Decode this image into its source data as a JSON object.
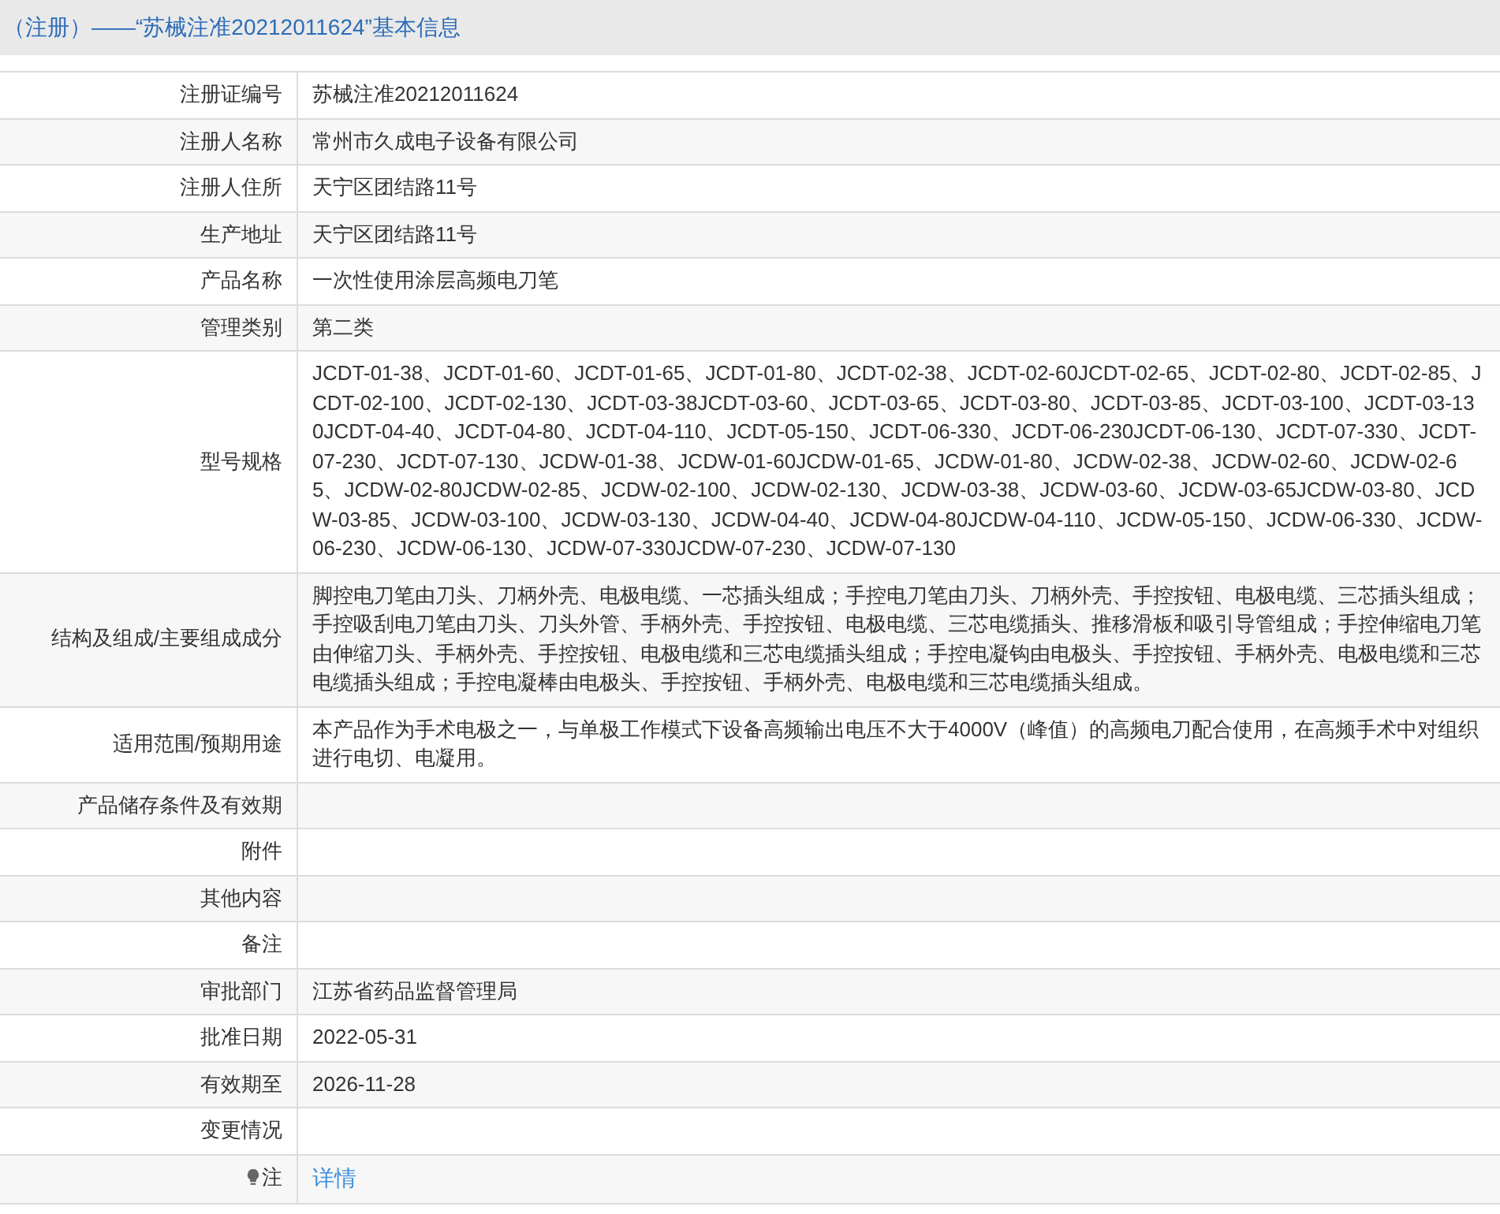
{
  "title": "（注册）——“苏械注准20212011624”基本信息",
  "rows": [
    {
      "kind": "text",
      "label": "注册证编号",
      "value": "苏械注准20212011624"
    },
    {
      "kind": "text",
      "label": "注册人名称",
      "value": "常州市久成电子设备有限公司"
    },
    {
      "kind": "text",
      "label": "注册人住所",
      "value": "天宁区团结路11号"
    },
    {
      "kind": "text",
      "label": "生产地址",
      "value": "天宁区团结路11号"
    },
    {
      "kind": "text",
      "label": "产品名称",
      "value": "一次性使用涂层高频电刀笔"
    },
    {
      "kind": "text",
      "label": "管理类别",
      "value": "第二类"
    },
    {
      "kind": "text",
      "label": "型号规格",
      "value": "JCDT-01-38、JCDT-01-60、JCDT-01-65、JCDT-01-80、JCDT-02-38、JCDT-02-60JCDT-02-65、JCDT-02-80、JCDT-02-85、JCDT-02-100、JCDT-02-130、JCDT-03-38JCDT-03-60、JCDT-03-65、JCDT-03-80、JCDT-03-85、JCDT-03-100、JCDT-03-130JCDT-04-40、JCDT-04-80、JCDT-04-110、JCDT-05-150、JCDT-06-330、JCDT-06-230JCDT-06-130、JCDT-07-330、JCDT-07-230、JCDT-07-130、JCDW-01-38、JCDW-01-60JCDW-01-65、JCDW-01-80、JCDW-02-38、JCDW-02-60、JCDW-02-65、JCDW-02-80JCDW-02-85、JCDW-02-100、JCDW-02-130、JCDW-03-38、JCDW-03-60、JCDW-03-65JCDW-03-80、JCDW-03-85、JCDW-03-100、JCDW-03-130、JCDW-04-40、JCDW-04-80JCDW-04-110、JCDW-05-150、JCDW-06-330、JCDW-06-230、JCDW-06-130、JCDW-07-330JCDW-07-230、JCDW-07-130"
    },
    {
      "kind": "text",
      "label": "结构及组成/主要组成成分",
      "value": "脚控电刀笔由刀头、刀柄外壳、电极电缆、一芯插头组成；手控电刀笔由刀头、刀柄外壳、手控按钮、电极电缆、三芯插头组成；手控吸刮电刀笔由刀头、刀头外管、手柄外壳、手控按钮、电极电缆、三芯电缆插头、推移滑板和吸引导管组成；手控伸缩电刀笔由伸缩刀头、手柄外壳、手控按钮、电极电缆和三芯电缆插头组成；手控电凝钩由电极头、手控按钮、手柄外壳、电极电缆和三芯电缆插头组成；手控电凝棒由电极头、手控按钮、手柄外壳、电极电缆和三芯电缆插头组成。"
    },
    {
      "kind": "text",
      "label": "适用范围/预期用途",
      "value": "本产品作为手术电极之一，与单极工作模式下设备高频输出电压不大于4000V（峰值）的高频电刀配合使用，在高频手术中对组织进行电切、电凝用。"
    },
    {
      "kind": "text",
      "label": "产品储存条件及有效期"
    },
    {
      "kind": "text",
      "label": "附件"
    },
    {
      "kind": "text",
      "label": "其他内容"
    },
    {
      "kind": "text",
      "label": "备注"
    },
    {
      "kind": "text",
      "label": "审批部门",
      "value": "江苏省药品监督管理局"
    },
    {
      "kind": "text",
      "label": "批准日期",
      "value": "2022-05-31"
    },
    {
      "kind": "text",
      "label": "有效期至",
      "value": "2026-11-28"
    },
    {
      "kind": "text",
      "label": "变更情况"
    },
    {
      "kind": "link",
      "label": "注",
      "value": "详情"
    }
  ]
}
